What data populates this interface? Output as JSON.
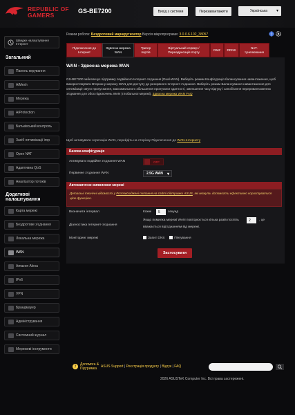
{
  "header": {
    "brand_line1": "REPUBLIC OF",
    "brand_line2": "GAMERS",
    "model": "GS-BE7200",
    "logout_label": "Вихід з системи",
    "reboot_label": "Перезавантажити",
    "language": "Українська"
  },
  "sidebar": {
    "quick_setup": "Швидке налаштування Інтернет",
    "general_heading": "Загальний",
    "general_items": [
      {
        "label": "Панель керування",
        "icon": "dashboard-icon"
      },
      {
        "label": "AiMesh",
        "icon": "aimesh-icon"
      },
      {
        "label": "Мережа",
        "icon": "network-icon"
      },
      {
        "label": "AiProtection",
        "icon": "shield-icon"
      },
      {
        "label": "Батьківський контроль",
        "icon": "parental-icon"
      },
      {
        "label": "Засіб оптимізації ігор",
        "icon": "game-boost-icon"
      },
      {
        "label": "Open NAT",
        "icon": "open-nat-icon"
      },
      {
        "label": "Адаптивна QoS",
        "icon": "qos-icon"
      },
      {
        "label": "Аналізатор потоків",
        "icon": "traffic-analyzer-icon"
      }
    ],
    "advanced_heading_line1": "Додаткові",
    "advanced_heading_line2": "налаштування",
    "advanced_items": [
      {
        "label": "Карта мережі",
        "icon": "network-map-icon"
      },
      {
        "label": "Бездротове з'єднання",
        "icon": "wireless-icon"
      },
      {
        "label": "Локальна мережа",
        "icon": "lan-icon"
      },
      {
        "label": "WAN",
        "icon": "wan-icon",
        "active": true
      },
      {
        "label": "Amazon Alexa",
        "icon": "alexa-icon"
      },
      {
        "label": "IPv6",
        "icon": "ipv6-icon"
      },
      {
        "label": "VPN",
        "icon": "vpn-icon"
      },
      {
        "label": "Брандмауер",
        "icon": "firewall-icon"
      },
      {
        "label": "Адміністрування",
        "icon": "admin-icon"
      },
      {
        "label": "Системний журнал",
        "icon": "syslog-icon"
      },
      {
        "label": "Мережеві інструменти",
        "icon": "network-tools-icon"
      }
    ]
  },
  "info": {
    "mode_label": "Режим роботи:",
    "mode_value": "Бездротовий маршрутизатор",
    "fw_label": "Версія мікропрограми:",
    "fw_value": "3.0.0.6.102_38057"
  },
  "tabs": [
    "Підключення до Інтернет",
    "Здвоєна мережа WAN",
    "Тригер портів",
    "Віртуальний сервер / Переадресація порту",
    "DMZ",
    "DDNS",
    "NAT-тунелювання"
  ],
  "panel": {
    "title": "WAN - Здвоєна мережа WAN",
    "description": "GS-BE7200 забезпечує підтримку подвійного Інтернет-з'єднання (Dual-WAN). Виберіть режим Конфігурація балансування навантаження, щоб використовувати Вторинну мережу WAN для доступу до резервного Інтернет-з'єднання. Виберіть режим Балансування навантаження для оптимізації смуги пропускання, максимального збільшення пропускної здатності, зменшення часу відгуку і запобігання переривантаженню з'єднання для обох підключень WAN (глобальної мережі).",
    "description_link": "Здвоєна мережа WAN FAQ",
    "note": "Щоб активувати Агрегацію WAN, перейдіть на сторінку Підключення до",
    "note_link": "WAN-Інтернету",
    "basic_config_heading": "Базова конфігурація",
    "dual_wan_label": "Активувати подвійне з'єднання WAN",
    "dual_wan_state": "OFF",
    "primary_wan_label": "Первинне з'єднання WAN",
    "primary_wan_value": "2.5G WAN",
    "auto_heading": "Автоматичне виявлення мережі",
    "auto_warning_prefix": "Детальні технічні відомості у",
    "auto_warning_link": "Розповсюджені питання на сайті підтримки ASUS",
    "auto_warning_suffix": ", які можуть допомогти ефективно користуватися цією функцією.",
    "detect_interval_label": "Визначити інтервал",
    "detect_every": "Кожні",
    "detect_interval_value": "5",
    "detect_unit": "секунд",
    "diag_label": "Діагностика Інтернет-з'єднання",
    "diag_text_prefix": "Якщо помилка мережі WAN повторюється кілька разів поспіль",
    "diag_count_value": "2",
    "diag_text_suffix": ", це",
    "diag_text_line2": "вважається від'єднанням від мережі.",
    "monitor_label": "Моніторинг мережі",
    "monitor_dns": "Запит DNS",
    "monitor_ping": "Пінгування",
    "apply_label": "Застосувати"
  },
  "footer": {
    "help_line1": "Допомога &",
    "help_line2": "Підтримка",
    "links": [
      "ASUS Support",
      "Реєстрація продукту",
      "Відгук",
      "FAQ"
    ],
    "copyright": "2026 ASUSTeK Computer Inc. Всі права застережені."
  },
  "colors": {
    "accent_red": "#a31e24",
    "link_yellow": "#ffd24a",
    "background": "#0b0b0d"
  }
}
